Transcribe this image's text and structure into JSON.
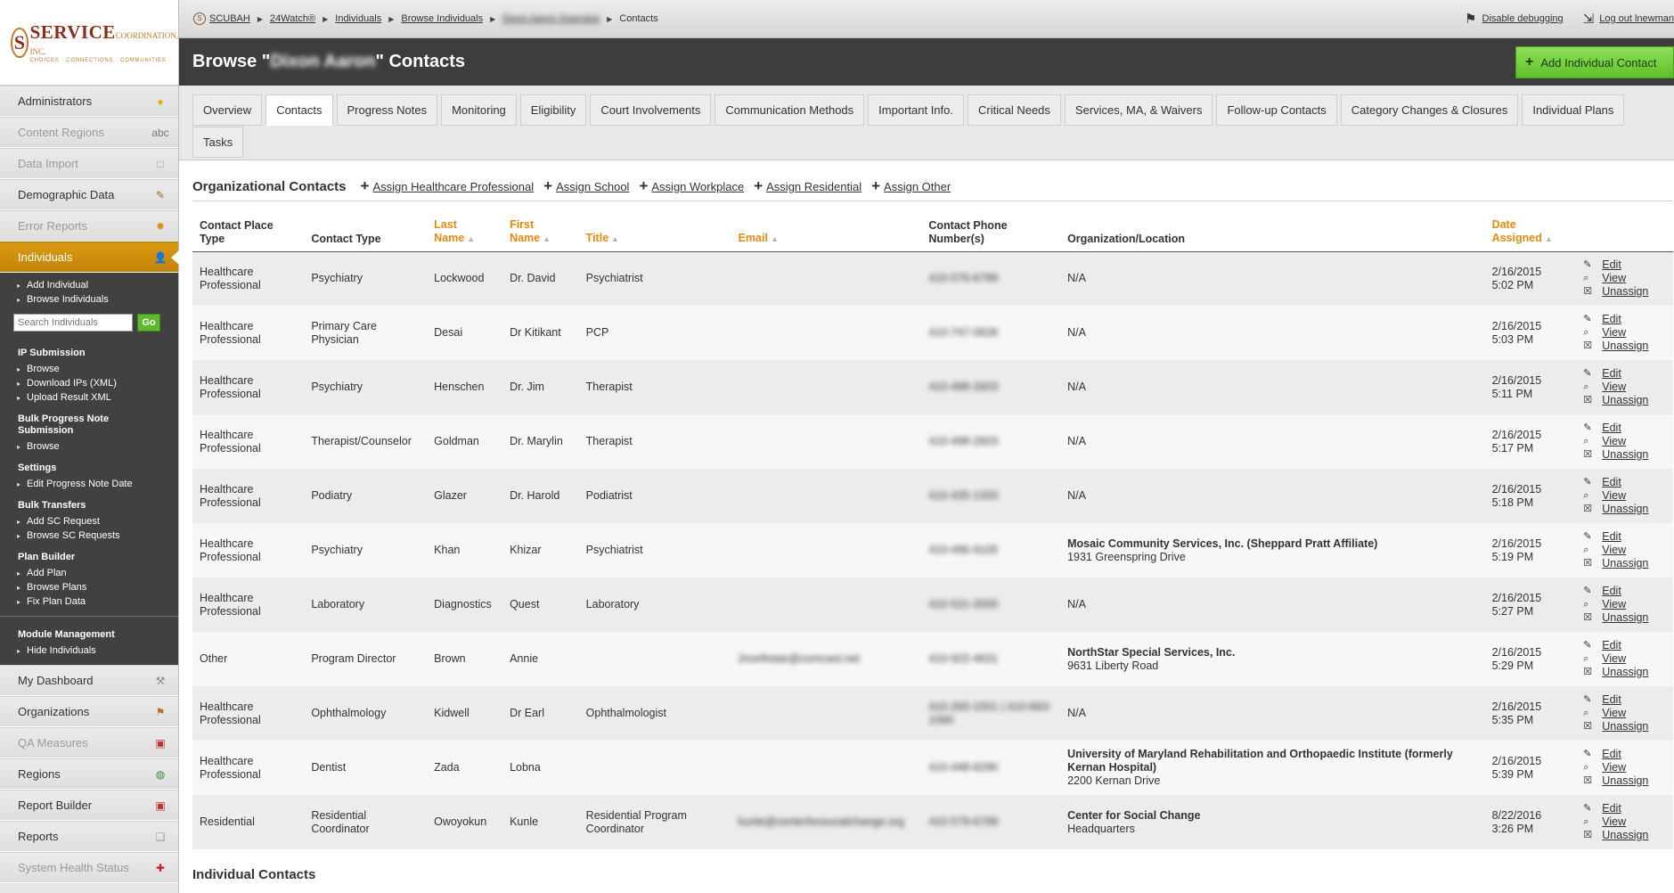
{
  "logo": {
    "mark": "S",
    "name": "SERVICE",
    "suffix": "COORDINATION, INC.",
    "tagline": "CHOICES · CONNECTIONS · COMMUNITIES"
  },
  "breadcrumb": [
    {
      "label": "SCUBAH"
    },
    {
      "label": "24Watch®"
    },
    {
      "label": "Individuals"
    },
    {
      "label": "Browse Individuals"
    },
    {
      "label": "Dixon Aaron Overview",
      "blurred": true
    },
    {
      "label": "Contacts"
    }
  ],
  "toplinks": {
    "debug": "Disable debugging",
    "logout": "Log out lnewman"
  },
  "header": {
    "title_prefix": "Browse \"",
    "title_name": "Dixon Aaron",
    "title_suffix": "\" Contacts",
    "add_button": "Add Individual Contact"
  },
  "sidebar": {
    "items_top": [
      {
        "label": "Administrators",
        "icon": "lightbulb-icon",
        "glyph": "●",
        "color": "#e2b00c",
        "disabled": false
      },
      {
        "label": "Content Regions",
        "icon": "spellcheck-icon",
        "glyph": "abc",
        "color": "#777",
        "disabled": true
      },
      {
        "label": "Data Import",
        "icon": "import-icon",
        "glyph": "□",
        "color": "#999",
        "disabled": true
      },
      {
        "label": "Demographic Data",
        "icon": "pencil-icon",
        "glyph": "✎",
        "color": "#a06a20",
        "disabled": false
      },
      {
        "label": "Error Reports",
        "icon": "gear-icon",
        "glyph": "✹",
        "color": "#e08a12",
        "disabled": true
      }
    ],
    "active": {
      "label": "Individuals",
      "icon": "person-icon",
      "glyph": "👤"
    },
    "sub": {
      "links_1": [
        "Add Individual",
        "Browse Individuals"
      ],
      "search_placeholder": "Search Individuals",
      "go": "Go",
      "ip_head": "IP Submission",
      "ip_links": [
        "Browse",
        "Download IPs (XML)",
        "Upload Result XML"
      ],
      "bulk_head": "Bulk Progress Note Submission",
      "bulk_links": [
        "Browse"
      ],
      "settings_head": "Settings",
      "settings_links": [
        "Edit Progress Note Date"
      ],
      "transfer_head": "Bulk Transfers",
      "transfer_links": [
        "Add SC Request",
        "Browse SC Requests"
      ],
      "plan_head": "Plan Builder",
      "plan_links": [
        "Add Plan",
        "Browse Plans",
        "Fix Plan Data"
      ],
      "module_head": "Module Management",
      "module_links": [
        "Hide Individuals"
      ]
    },
    "items_bottom": [
      {
        "label": "My Dashboard",
        "icon": "dashboard-icon",
        "glyph": "⚒",
        "color": "#888",
        "disabled": false
      },
      {
        "label": "Organizations",
        "icon": "group-icon",
        "glyph": "⚑",
        "color": "#c07020",
        "disabled": false
      },
      {
        "label": "QA Measures",
        "icon": "qa-icon",
        "glyph": "▣",
        "color": "#c03030",
        "disabled": true
      },
      {
        "label": "Regions",
        "icon": "globe-icon",
        "glyph": "◍",
        "color": "#3a8a3a",
        "disabled": false
      },
      {
        "label": "Report Builder",
        "icon": "report-builder-icon",
        "glyph": "▣",
        "color": "#c03030",
        "disabled": false
      },
      {
        "label": "Reports",
        "icon": "reports-icon",
        "glyph": "❏",
        "color": "#999",
        "disabled": false
      },
      {
        "label": "System Health Status",
        "icon": "health-icon",
        "glyph": "✚",
        "color": "#d02020",
        "disabled": true
      }
    ]
  },
  "tabs": [
    {
      "label": "Overview",
      "active": false
    },
    {
      "label": "Contacts",
      "active": true
    },
    {
      "label": "Progress Notes",
      "active": false
    },
    {
      "label": "Monitoring",
      "active": false
    },
    {
      "label": "Eligibility",
      "active": false
    },
    {
      "label": "Court Involvements",
      "active": false
    },
    {
      "label": "Communication Methods",
      "active": false
    },
    {
      "label": "Important Info.",
      "active": false
    },
    {
      "label": "Critical Needs",
      "active": false
    },
    {
      "label": "Services, MA, & Waivers",
      "active": false
    },
    {
      "label": "Follow-up Contacts",
      "active": false
    },
    {
      "label": "Category Changes & Closures",
      "active": false
    },
    {
      "label": "Individual Plans",
      "active": false
    },
    {
      "label": "Tasks",
      "active": false
    }
  ],
  "org_contacts": {
    "heading": "Organizational Contacts",
    "assign_links": [
      "Assign Healthcare Professional",
      "Assign School",
      "Assign Workplace",
      "Assign Residential",
      "Assign Other"
    ],
    "columns": [
      {
        "label": "Contact Place Type",
        "sortable": false
      },
      {
        "label": "Contact Type",
        "sortable": false
      },
      {
        "label": "Last Name",
        "sortable": true
      },
      {
        "label": "First Name",
        "sortable": true
      },
      {
        "label": "Title",
        "sortable": true
      },
      {
        "label": "Email",
        "sortable": true
      },
      {
        "label": "Contact Phone Number(s)",
        "sortable": false
      },
      {
        "label": "Organization/Location",
        "sortable": false
      },
      {
        "label": "Date Assigned",
        "sortable": true
      },
      {
        "label": "",
        "sortable": false
      }
    ],
    "actions": {
      "edit": "Edit",
      "view": "View",
      "unassign": "Unassign"
    },
    "rows": [
      {
        "place": "Healthcare Professional",
        "type": "Psychiatry",
        "last": "Lockwood",
        "first": "Dr. David",
        "title": "Psychiatrist",
        "email": "",
        "phone": "410-576-6789",
        "org": "N/A",
        "org_addr": "",
        "org_bold": false,
        "date": "2/16/2015",
        "time": "5:02 PM"
      },
      {
        "place": "Healthcare Professional",
        "type": "Primary Care Physician",
        "last": "Desai",
        "first": "Dr Kitikant",
        "title": "PCP",
        "email": "",
        "phone": "410-747-0626",
        "org": "N/A",
        "org_addr": "",
        "org_bold": false,
        "date": "2/16/2015",
        "time": "5:03 PM"
      },
      {
        "place": "Healthcare Professional",
        "type": "Psychiatry",
        "last": "Henschen",
        "first": "Dr. Jim",
        "title": "Therapist",
        "email": "",
        "phone": "410-498-2603",
        "org": "N/A",
        "org_addr": "",
        "org_bold": false,
        "date": "2/16/2015",
        "time": "5:11 PM"
      },
      {
        "place": "Healthcare Professional",
        "type": "Therapist/Counselor",
        "last": "Goldman",
        "first": "Dr. Marylin",
        "title": "Therapist",
        "email": "",
        "phone": "410-498-2603",
        "org": "N/A",
        "org_addr": "",
        "org_bold": false,
        "date": "2/16/2015",
        "time": "5:17 PM"
      },
      {
        "place": "Healthcare Professional",
        "type": "Podiatry",
        "last": "Glazer",
        "first": "Dr. Harold",
        "title": "Podiatrist",
        "email": "",
        "phone": "410-435-1333",
        "org": "N/A",
        "org_addr": "",
        "org_bold": false,
        "date": "2/16/2015",
        "time": "5:18 PM"
      },
      {
        "place": "Healthcare Professional",
        "type": "Psychiatry",
        "last": "Khan",
        "first": "Khizar",
        "title": "Psychiatrist",
        "email": "",
        "phone": "410-496-9105",
        "org": "Mosaic Community Services, Inc. (Sheppard Pratt Affiliate)",
        "org_addr": "1931 Greenspring Drive",
        "org_bold": true,
        "date": "2/16/2015",
        "time": "5:19 PM"
      },
      {
        "place": "Healthcare Professional",
        "type": "Laboratory",
        "last": "Diagnostics",
        "first": "Quest",
        "title": "Laboratory",
        "email": "",
        "phone": "410-521-3500",
        "org": "N/A",
        "org_addr": "",
        "org_bold": false,
        "date": "2/16/2015",
        "time": "5:27 PM"
      },
      {
        "place": "Other",
        "type": "Program Director",
        "last": "Brown",
        "first": "Annie",
        "title": "",
        "email": "2northstar@comcast.net",
        "phone": "410-922-4631",
        "org": "NorthStar Special Services, Inc.",
        "org_addr": "9631 Liberty Road",
        "org_bold": true,
        "date": "2/16/2015",
        "time": "5:29 PM"
      },
      {
        "place": "Healthcare Professional",
        "type": "Ophthalmology",
        "last": "Kidwell",
        "first": "Dr Earl",
        "title": "Ophthalmologist",
        "email": "",
        "phone": "410-265-1501 | 410-663-1590",
        "org": "N/A",
        "org_addr": "",
        "org_bold": false,
        "date": "2/16/2015",
        "time": "5:35 PM"
      },
      {
        "place": "Healthcare Professional",
        "type": "Dentist",
        "last": "Zada",
        "first": "Lobna",
        "title": "",
        "email": "",
        "phone": "410-448-6290",
        "org": "University of Maryland Rehabilitation and Orthopaedic Institute (formerly Kernan Hospital)",
        "org_addr": "2200 Kernan Drive",
        "org_bold": true,
        "date": "2/16/2015",
        "time": "5:39 PM"
      },
      {
        "place": "Residential",
        "type": "Residential Coordinator",
        "last": "Owoyokun",
        "first": "Kunle",
        "title": "Residential Program Coordinator",
        "email": "kunle@centerforsocialchange.org",
        "phone": "410-579-6789",
        "org": "Center for Social Change",
        "org_addr": "Headquarters",
        "org_bold": true,
        "date": "8/22/2016",
        "time": "3:26 PM"
      }
    ]
  },
  "indiv_contacts": {
    "heading": "Individual Contacts"
  }
}
